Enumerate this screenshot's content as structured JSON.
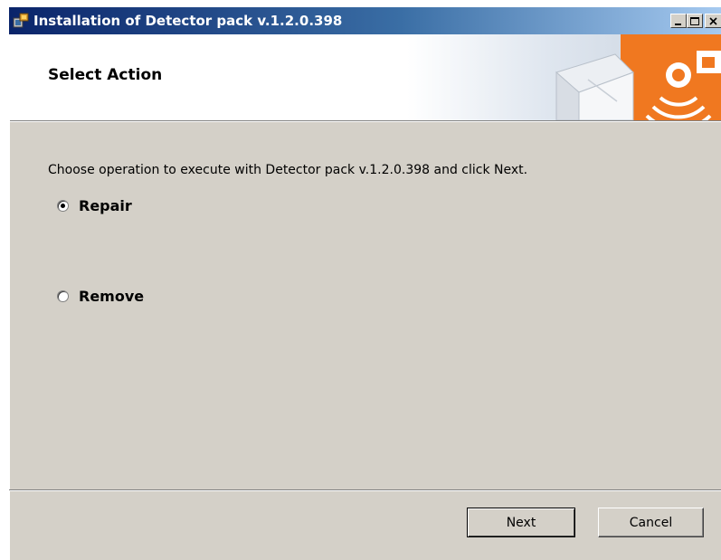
{
  "window": {
    "title": "Installation of Detector pack v.1.2.0.398",
    "title_icon": "installer-icon",
    "controls": {
      "minimize_icon": "minimize-icon",
      "maximize_icon": "maximize-icon",
      "close_icon": "close-icon"
    }
  },
  "banner": {
    "title": "Select Action",
    "art": "box-and-signal-graphic"
  },
  "content": {
    "instruction": "Choose operation to execute with Detector pack v.1.2.0.398 and click Next.",
    "options": [
      {
        "label": "Repair",
        "selected": true
      },
      {
        "label": "Remove",
        "selected": false
      }
    ]
  },
  "footer": {
    "next_label": "Next",
    "cancel_label": "Cancel"
  },
  "colors": {
    "titlebar_start": "#0a246a",
    "titlebar_end": "#a6caf0",
    "dialog_bg": "#d4d0c8",
    "banner_accent": "#f07820"
  }
}
